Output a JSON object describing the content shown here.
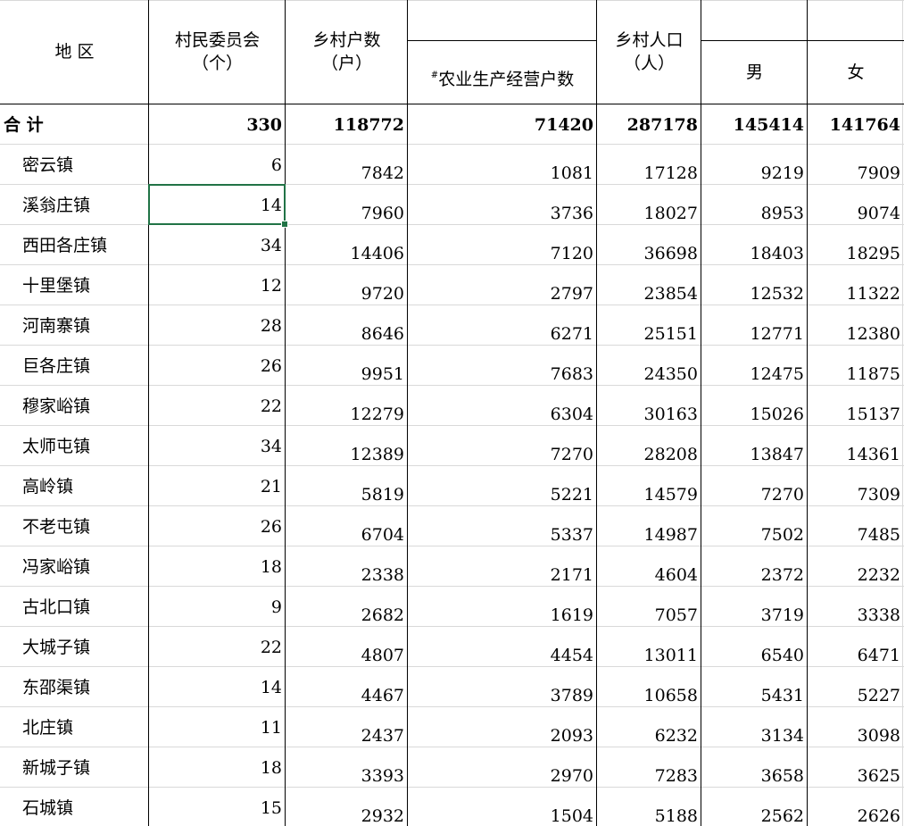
{
  "header": {
    "region": "地  区",
    "committees": "村民委员会",
    "committees_unit": "（个）",
    "households": "乡村户数",
    "households_unit": "（户）",
    "agri_mark": "#",
    "agri_households": "农业生产经营户数",
    "population": "乡村人口",
    "population_unit": "（人）",
    "male": "男",
    "female": "女"
  },
  "total": {
    "name": "合  计",
    "committees": "330",
    "households": "118772",
    "agri": "71420",
    "population": "287178",
    "male": "145414",
    "female": "141764"
  },
  "rows": [
    {
      "name": "密云镇",
      "committees": "6",
      "households": "7842",
      "agri": "1081",
      "population": "17128",
      "male": "9219",
      "female": "7909"
    },
    {
      "name": "溪翁庄镇",
      "committees": "14",
      "households": "7960",
      "agri": "3736",
      "population": "18027",
      "male": "8953",
      "female": "9074"
    },
    {
      "name": "西田各庄镇",
      "committees": "34",
      "households": "14406",
      "agri": "7120",
      "population": "36698",
      "male": "18403",
      "female": "18295"
    },
    {
      "name": "十里堡镇",
      "committees": "12",
      "households": "9720",
      "agri": "2797",
      "population": "23854",
      "male": "12532",
      "female": "11322"
    },
    {
      "name": "河南寨镇",
      "committees": "28",
      "households": "8646",
      "agri": "6271",
      "population": "25151",
      "male": "12771",
      "female": "12380"
    },
    {
      "name": "巨各庄镇",
      "committees": "26",
      "households": "9951",
      "agri": "7683",
      "population": "24350",
      "male": "12475",
      "female": "11875"
    },
    {
      "name": "穆家峪镇",
      "committees": "22",
      "households": "12279",
      "agri": "6304",
      "population": "30163",
      "male": "15026",
      "female": "15137"
    },
    {
      "name": "太师屯镇",
      "committees": "34",
      "households": "12389",
      "agri": "7270",
      "population": "28208",
      "male": "13847",
      "female": "14361"
    },
    {
      "name": "高岭镇",
      "committees": "21",
      "households": "5819",
      "agri": "5221",
      "population": "14579",
      "male": "7270",
      "female": "7309"
    },
    {
      "name": "不老屯镇",
      "committees": "26",
      "households": "6704",
      "agri": "5337",
      "population": "14987",
      "male": "7502",
      "female": "7485"
    },
    {
      "name": "冯家峪镇",
      "committees": "18",
      "households": "2338",
      "agri": "2171",
      "population": "4604",
      "male": "2372",
      "female": "2232"
    },
    {
      "name": "古北口镇",
      "committees": "9",
      "households": "2682",
      "agri": "1619",
      "population": "7057",
      "male": "3719",
      "female": "3338"
    },
    {
      "name": "大城子镇",
      "committees": "22",
      "households": "4807",
      "agri": "4454",
      "population": "13011",
      "male": "6540",
      "female": "6471"
    },
    {
      "name": "东邵渠镇",
      "committees": "14",
      "households": "4467",
      "agri": "3789",
      "population": "10658",
      "male": "5431",
      "female": "5227"
    },
    {
      "name": "北庄镇",
      "committees": "11",
      "households": "2437",
      "agri": "2093",
      "population": "6232",
      "male": "3134",
      "female": "3098"
    },
    {
      "name": "新城子镇",
      "committees": "18",
      "households": "3393",
      "agri": "2970",
      "population": "7283",
      "male": "3658",
      "female": "3625"
    },
    {
      "name": "石城镇",
      "committees": "15",
      "households": "2932",
      "agri": "1504",
      "population": "5188",
      "male": "2562",
      "female": "2626"
    }
  ],
  "selection": {
    "row": 1,
    "column": "committees"
  },
  "colors": {
    "grid": "#d9d9d9",
    "border": "#000000",
    "selection": "#217346"
  }
}
